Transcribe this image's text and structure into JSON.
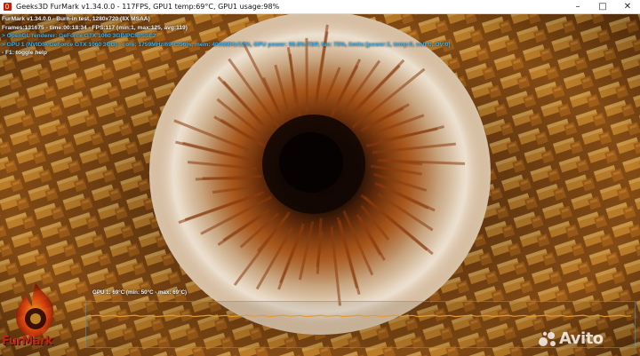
{
  "window": {
    "title": "Geeks3D FurMark v1.34.0.0 - 117FPS, GPU1 temp:69°C, GPU1 usage:98%"
  },
  "overlay": {
    "line1": "FurMark v1.34.0.0 - Burn-in test, 1280x720 (8X MSAA)",
    "line2": "Frames:131675 - time:00:18:34 - FPS:117 (min:1, max:125, avg:119)",
    "line3": "> OpenGL renderer: GeForce GTX 1060 3GB/PCIe/SSE2",
    "line4": "> GPU 1 (NVIDIA GeForce GTX 1060 3GB) - core: 1759MHz/69°C/96%, mem: 4006MHz/12%, GPU power: 98.8% TDP, fan: 75%, limits:[power:1, temp:0, volt:0, OV:0]",
    "line5": "- F1: toggle help"
  },
  "temp_graph": {
    "label": "GPU 1: 69°C (min: 50°C - max: 69°C)",
    "current_temp_c": 69,
    "line_color": "#e89a2a"
  },
  "logo": {
    "text": "FurMark"
  },
  "watermark": {
    "text": "Avito"
  }
}
